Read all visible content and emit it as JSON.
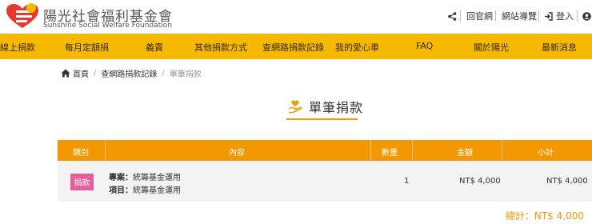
{
  "header": {
    "brand_cn": "陽光社會福利基金會",
    "brand_en": "Sunshine Social Welfare Foundation",
    "util": {
      "home_label": "回官網",
      "sitemap_label": "網站導覽",
      "login_label": "登入"
    }
  },
  "nav": {
    "items": [
      "線上捐款",
      "每月定額捐",
      "義賣",
      "其他捐款方式",
      "查網路捐款記錄",
      "我的愛心車",
      "FAQ",
      "關於陽光",
      "最新消息"
    ]
  },
  "breadcrumb": {
    "home": "首頁",
    "level2": "查網路捐款記錄",
    "current": "單筆捐款"
  },
  "page": {
    "title": "單筆捐款"
  },
  "table": {
    "headers": [
      "類別",
      "內容",
      "數量",
      "金額",
      "小計"
    ],
    "rows": [
      {
        "category": "捐款",
        "project_label": "專案：",
        "project_value": "統籌基金運用",
        "item_label": "項目：",
        "item_value": "統籌基金運用",
        "quantity": "1",
        "amount": "NT$ 4,000",
        "subtotal": "NT$ 4,000"
      }
    ],
    "total": "總計：NT$ 4,000"
  },
  "colors": {
    "nav_bg": "#f7b800",
    "table_head_bg": "#f39800",
    "accent": "#f39800",
    "badge_bg": "#e65d9c"
  },
  "icons": [
    "logo-mark",
    "share-icon",
    "sitemap-icon",
    "login-icon",
    "user-icon",
    "home-icon",
    "donate-hand-heart-icon"
  ]
}
